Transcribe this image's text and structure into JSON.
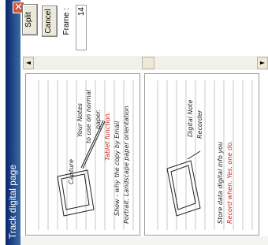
{
  "window": {
    "title": "Track digital page",
    "close_glyph": "✕"
  },
  "controls": {
    "split_label": "Split",
    "cancel_label": "Cancel",
    "frame_label": "Frame :",
    "frame_value": "14"
  },
  "scrollbar": {
    "left_arrow": "◄",
    "right_arrow": "►"
  },
  "pages": [
    {
      "notes": [
        "Capture",
        "Your Notes",
        "to use on normal",
        "paper.",
        "Tablet function.",
        "Show - why the copy by Email",
        "Portrait. Landscape paper orientation"
      ]
    },
    {
      "notes": [
        "Digital Note",
        "Recorder",
        "Store data digital info you",
        "Record when. Yes. one do."
      ]
    }
  ],
  "colors": {
    "title_bar": "#0a246a",
    "title_bar_light": "#3a6ea5",
    "close_button": "#d4543a",
    "ink": "#222222",
    "ink_red": "#c81e1e",
    "rule_line": "#b9b9b9"
  }
}
